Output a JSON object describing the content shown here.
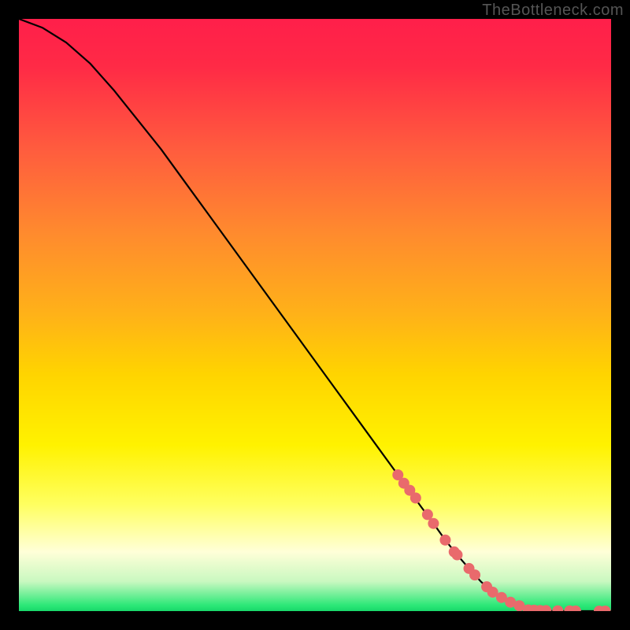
{
  "watermark": "TheBottleneck.com",
  "chart_data": {
    "type": "line",
    "title": "",
    "xlabel": "",
    "ylabel": "",
    "xlim": [
      0,
      100
    ],
    "ylim": [
      0,
      100
    ],
    "x": [
      0,
      4,
      8,
      12,
      16,
      20,
      24,
      28,
      32,
      36,
      40,
      44,
      48,
      52,
      56,
      60,
      64,
      68,
      70,
      72,
      74,
      76,
      78,
      80,
      82,
      84,
      85,
      86,
      88,
      90,
      92,
      94,
      96,
      98,
      100
    ],
    "values": [
      100,
      98.5,
      96,
      92.5,
      88,
      83,
      78,
      72.5,
      67,
      61.5,
      56,
      50.5,
      45,
      39.5,
      34,
      28.5,
      23,
      17.5,
      14.8,
      12,
      9.5,
      7.2,
      5,
      3.2,
      1.8,
      0.8,
      0.4,
      0.2,
      0.05,
      0.02,
      0.01,
      0,
      0,
      0,
      0
    ],
    "series": [
      {
        "name": "curve",
        "x": [
          0,
          4,
          8,
          12,
          16,
          20,
          24,
          28,
          32,
          36,
          40,
          44,
          48,
          52,
          56,
          60,
          64,
          68,
          70,
          72,
          74,
          76,
          78,
          80,
          82,
          84,
          85,
          86,
          88,
          90,
          92,
          94,
          96,
          98,
          100
        ],
        "y": [
          100,
          98.5,
          96,
          92.5,
          88,
          83,
          78,
          72.5,
          67,
          61.5,
          56,
          50.5,
          45,
          39.5,
          34,
          28.5,
          23,
          17.5,
          14.8,
          12,
          9.5,
          7.2,
          5,
          3.2,
          1.8,
          0.8,
          0.4,
          0.2,
          0.05,
          0.02,
          0.01,
          0,
          0,
          0,
          0
        ]
      }
    ],
    "markers": {
      "name": "highlight-points",
      "color": "#e96a6c",
      "x": [
        64,
        65,
        66,
        67,
        69,
        70,
        72,
        73.5,
        74,
        76,
        77,
        79,
        80,
        81.5,
        83,
        84.5,
        86,
        87,
        88,
        89,
        91,
        93,
        94,
        98,
        99
      ],
      "y": [
        23,
        21.6,
        20.4,
        19.1,
        16.3,
        14.8,
        12,
        10,
        9.5,
        7.2,
        6.1,
        4.1,
        3.2,
        2.3,
        1.5,
        0.9,
        0.2,
        0.15,
        0.1,
        0.08,
        0.05,
        0.03,
        0.02,
        0.0,
        0.0
      ]
    },
    "colors": {
      "line": "#000000",
      "marker": "#e96a6c",
      "gradient_top": "#ff1f4a",
      "gradient_mid": "#ffd400",
      "gradient_bottom": "#18d86a",
      "background": "#000000"
    }
  }
}
